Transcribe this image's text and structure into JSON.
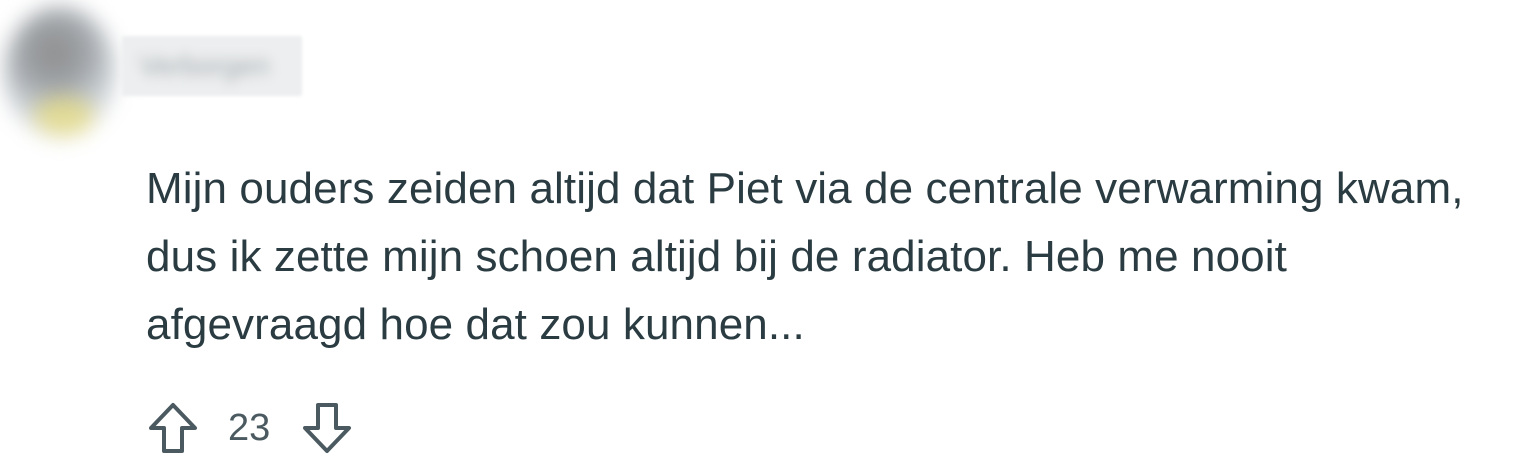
{
  "comment": {
    "author": "Verborgen",
    "body": "Mijn ouders zeiden altijd dat Piet via de centrale verwarming kwam, dus ik zette mijn schoen altijd bij de radiator. Heb me nooit afgevraagd hoe dat zou kunnen...",
    "score": "23"
  },
  "icons": {
    "upvote": "arrow-up-outline-icon",
    "downvote": "arrow-down-outline-icon"
  },
  "colors": {
    "text": "#2a3c42",
    "icon": "#4b5a60"
  }
}
